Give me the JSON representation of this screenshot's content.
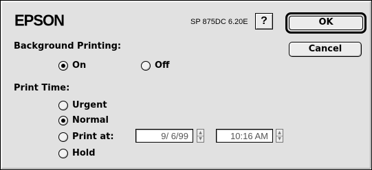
{
  "brand": "EPSON",
  "version": "SP 875DC 6.20E",
  "help_label": "?",
  "ok_label": "OK",
  "cancel_label": "Cancel",
  "background_printing": {
    "label": "Background Printing:",
    "on_label": "On",
    "off_label": "Off",
    "selected": "On"
  },
  "print_time": {
    "label": "Print Time:",
    "urgent_label": "Urgent",
    "normal_label": "Normal",
    "print_at_label": "Print at:",
    "hold_label": "Hold",
    "selected": "Normal",
    "date_value": "9/ 6/99",
    "time_value": "10:16 AM"
  },
  "icons": [
    "help-icon",
    "stepper-up-icon",
    "stepper-down-icon"
  ]
}
